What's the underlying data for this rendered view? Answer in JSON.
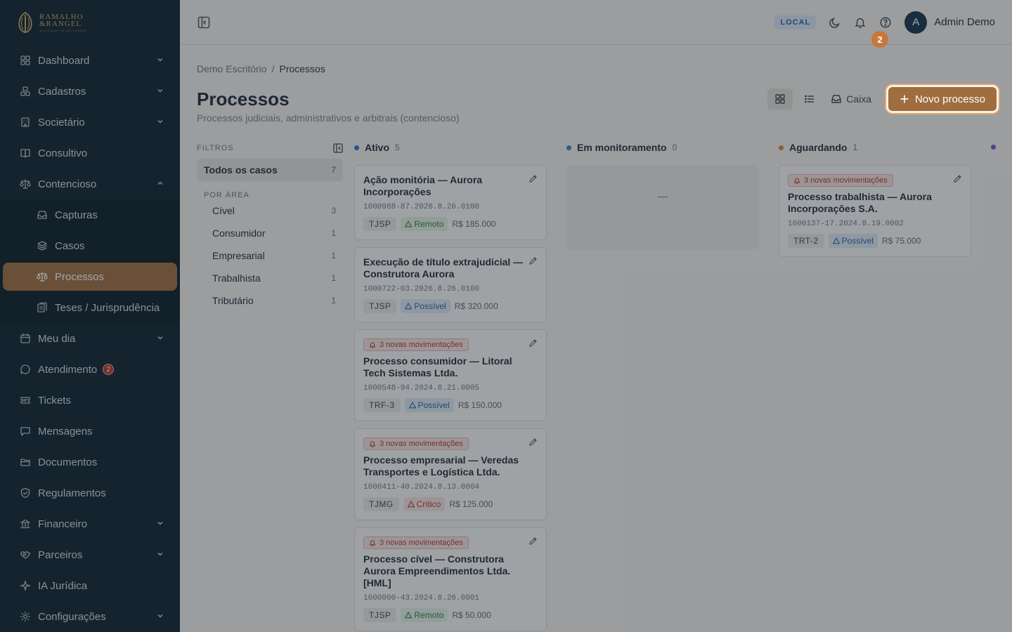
{
  "brand": {
    "line1": "RAMALHO",
    "line2": "&RANGEL",
    "line3": "SOCIEDADE DE ADVOGADOS"
  },
  "sidebar": {
    "items": [
      {
        "label": "Dashboard",
        "icon": "grid-icon",
        "expandable": true
      },
      {
        "label": "Cadastros",
        "icon": "boxes-icon",
        "expandable": true
      },
      {
        "label": "Societário",
        "icon": "building-icon",
        "expandable": true
      },
      {
        "label": "Consultivo",
        "icon": "book-icon",
        "expandable": false
      },
      {
        "label": "Contencioso",
        "icon": "scale-icon",
        "expandable": true,
        "expanded": true
      }
    ],
    "sub_items": [
      {
        "label": "Capturas",
        "icon": "inbox-icon"
      },
      {
        "label": "Casos",
        "icon": "layers-icon"
      },
      {
        "label": "Processos",
        "icon": "scale-icon",
        "active": true
      },
      {
        "label": "Teses / Jurisprudência",
        "icon": "library-icon"
      }
    ],
    "items_after": [
      {
        "label": "Meu dia",
        "icon": "calendar-icon",
        "expandable": true
      },
      {
        "label": "Atendimento",
        "icon": "chat-icon",
        "badge": "2"
      },
      {
        "label": "Tickets",
        "icon": "ticket-icon"
      },
      {
        "label": "Mensagens",
        "icon": "message-icon"
      },
      {
        "label": "Documentos",
        "icon": "folder-icon"
      },
      {
        "label": "Regulamentos",
        "icon": "shield-icon"
      },
      {
        "label": "Financeiro",
        "icon": "bank-icon",
        "expandable": true
      },
      {
        "label": "Parceiros",
        "icon": "handshake-icon",
        "expandable": true
      },
      {
        "label": "IA Jurídica",
        "icon": "sparkle-icon"
      },
      {
        "label": "Configurações",
        "icon": "gear-icon",
        "expandable": true
      }
    ]
  },
  "topbar": {
    "env": "LOCAL",
    "avatar_initial": "A",
    "user": "Admin Demo"
  },
  "breadcrumb": {
    "root": "Demo Escritório",
    "sep": "/",
    "current": "Processos"
  },
  "page": {
    "title": "Processos",
    "subtitle": "Processos judiciais, administrativos e arbitrais (contencioso)"
  },
  "toolbar": {
    "caixa": "Caixa",
    "new_label": "Novo processo",
    "step": "2"
  },
  "filters": {
    "heading": "FILTROS",
    "all": {
      "label": "Todos os casos",
      "count": "7"
    },
    "group": "POR ÁREA",
    "areas": [
      {
        "label": "Cível",
        "count": "3"
      },
      {
        "label": "Consumidor",
        "count": "1"
      },
      {
        "label": "Empresarial",
        "count": "1"
      },
      {
        "label": "Trabalhista",
        "count": "1"
      },
      {
        "label": "Tributário",
        "count": "1"
      }
    ]
  },
  "columns": [
    {
      "name": "Ativo",
      "count": "5",
      "color": "#2f6fd1",
      "cards": [
        {
          "alert": "",
          "title": "Ação monitória — Aurora Incorporações",
          "number": "1000988-87.2026.8.26.0100",
          "court": "TJSP",
          "risk": "Remoto",
          "risk_kind": "remoto",
          "value": "R$ 185.000"
        },
        {
          "alert": "",
          "title": "Execução de título extrajudicial — Construtora Aurora",
          "number": "1000722-03.2026.8.26.0100",
          "court": "TJSP",
          "risk": "Possível",
          "risk_kind": "possivel",
          "value": "R$ 320.000"
        },
        {
          "alert": "3 novas movimentações",
          "title": "Processo consumidor — Litoral Tech Sistemas Ltda.",
          "number": "1000548-94.2024.8.21.0005",
          "court": "TRF-3",
          "risk": "Possível",
          "risk_kind": "possivel",
          "value": "R$ 150.000"
        },
        {
          "alert": "3 novas movimentações",
          "title": "Processo empresarial — Veredas Transportes e Logística Ltda.",
          "number": "1000411-40.2024.8.13.0004",
          "court": "TJMG",
          "risk": "Crítico",
          "risk_kind": "critico",
          "value": "R$ 125.000"
        },
        {
          "alert": "3 novas movimentações",
          "title": "Processo cível — Construtora Aurora Empreendimentos Ltda. [HML]",
          "number": "1000000-43.2024.8.26.0001",
          "court": "TJSP",
          "risk": "Remoto",
          "risk_kind": "remoto",
          "value": "R$ 50.000"
        }
      ]
    },
    {
      "name": "Em monitoramento",
      "count": "0",
      "color": "#1f8fb0",
      "empty": "—",
      "cards": []
    },
    {
      "name": "Aguardando",
      "count": "1",
      "color": "#d9892b",
      "cards": [
        {
          "alert": "3 novas movimentações",
          "title": "Processo trabalhista — Aurora Incorporações S.A.",
          "number": "1000137-17.2024.8.19.0002",
          "court": "TRT-2",
          "risk": "Possível",
          "risk_kind": "possivel",
          "value": "R$ 75.000"
        }
      ]
    }
  ],
  "next_column_color": "#7a4fd6"
}
